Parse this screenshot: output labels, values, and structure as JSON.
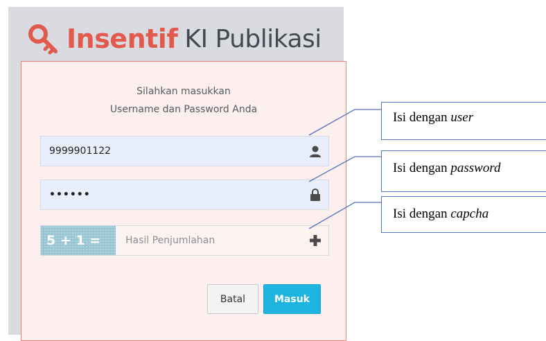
{
  "app": {
    "title_bold": "Insentif",
    "title_rest": "KI Publikasi",
    "brand_color": "#e25a4b"
  },
  "login": {
    "intro_line1": "Silahkan masukkan",
    "intro_line2": "Username dan Password Anda",
    "username_value": "9999901122",
    "password_value": "••••••",
    "captcha_question": "5 + 1 =",
    "captcha_placeholder": "Hasil Penjumlahan",
    "cancel_label": "Batal",
    "submit_label": "Masuk",
    "submit_color": "#1fb4e0",
    "icons": [
      "key-icon",
      "user-icon",
      "lock-icon",
      "plus-icon"
    ]
  },
  "callouts": [
    {
      "prefix": "Isi dengan ",
      "term": "user"
    },
    {
      "prefix": "Isi dengan ",
      "term": "password"
    },
    {
      "prefix": "Isi dengan ",
      "term": "capcha"
    }
  ]
}
